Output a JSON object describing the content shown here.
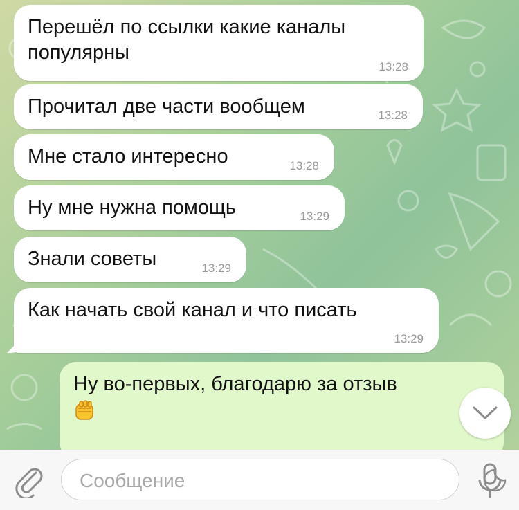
{
  "messages": [
    {
      "text": "Перешёл по ссылки какие каналы\nпопулярны",
      "time": "13:28"
    },
    {
      "text": "Прочитал две части вообщем",
      "time": "13:28"
    },
    {
      "text": "Мне стало интересно",
      "time": "13:28"
    },
    {
      "text": "Ну мне нужна помощь",
      "time": "13:29"
    },
    {
      "text": "Знали советы",
      "time": "13:29"
    },
    {
      "text": "Как начать свой канал и что писать",
      "time": "13:29"
    }
  ],
  "outgoing": {
    "text": "Ну во-первых, благодарю за отзыв",
    "emoji": "fist-emoji"
  },
  "composer": {
    "placeholder": "Сообщение"
  },
  "icons": {
    "attach": "paperclip-icon",
    "sticker": "sticker-icon",
    "mic": "microphone-icon",
    "scroll": "chevron-down-icon"
  },
  "colors": {
    "incoming_bg": "#ffffff",
    "outgoing_bg": "#e1f8cb",
    "time": "#9a9a9a"
  }
}
